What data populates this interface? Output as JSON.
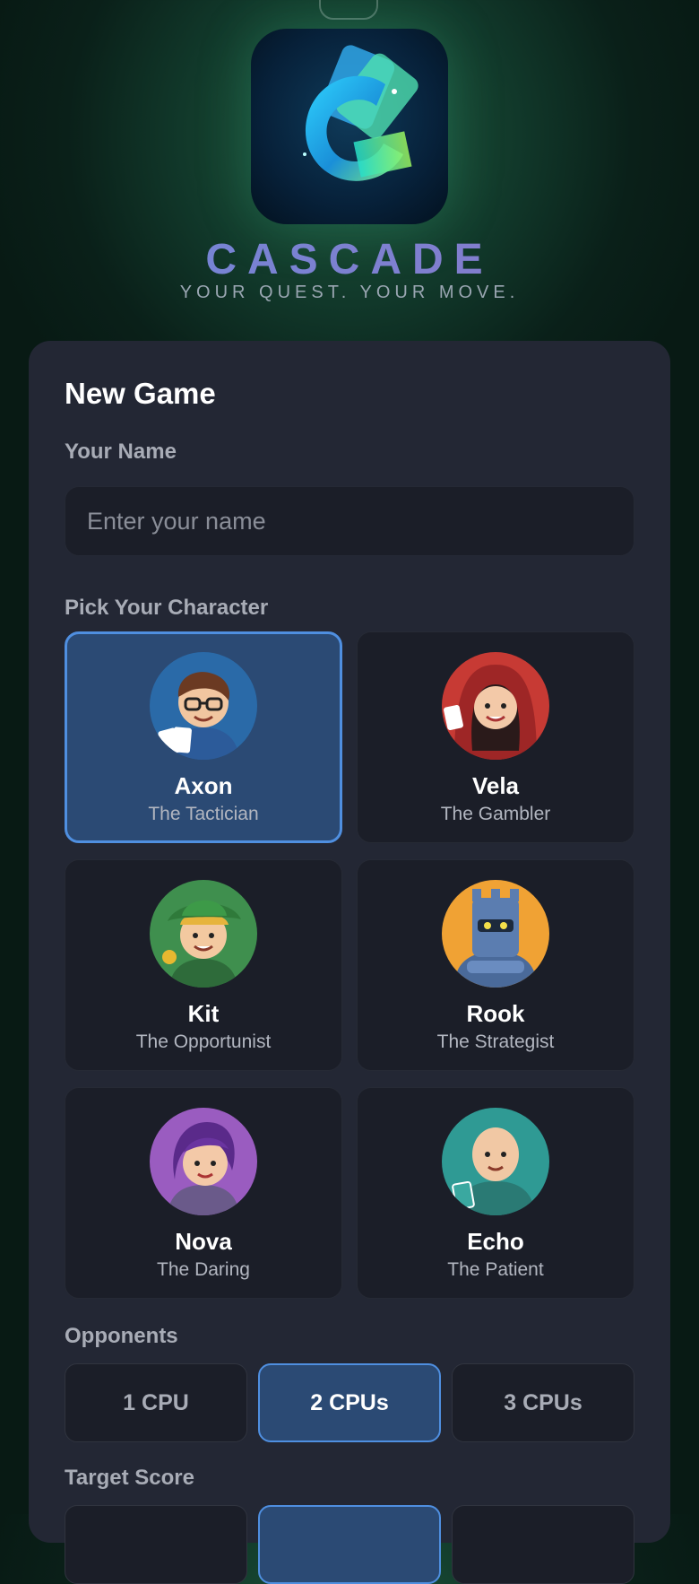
{
  "brand": {
    "title": "CASCADE",
    "tagline": "YOUR QUEST. YOUR MOVE."
  },
  "form": {
    "heading": "New Game",
    "name_label": "Your Name",
    "name_placeholder": "Enter your name",
    "name_value": "",
    "character_label": "Pick Your Character",
    "characters": [
      {
        "name": "Axon",
        "title": "The Tactician",
        "selected": true
      },
      {
        "name": "Vela",
        "title": "The Gambler",
        "selected": false
      },
      {
        "name": "Kit",
        "title": "The Opportunist",
        "selected": false
      },
      {
        "name": "Rook",
        "title": "The Strategist",
        "selected": false
      },
      {
        "name": "Nova",
        "title": "The Daring",
        "selected": false
      },
      {
        "name": "Echo",
        "title": "The Patient",
        "selected": false
      }
    ],
    "opponents_label": "Opponents",
    "opponents": [
      {
        "label": "1 CPU",
        "selected": false
      },
      {
        "label": "2 CPUs",
        "selected": true
      },
      {
        "label": "3 CPUs",
        "selected": false
      }
    ],
    "target_label": "Target Score"
  },
  "colors": {
    "accent": "#4f8fe0",
    "selected_bg": "#2b4a74",
    "card_bg": "#232734",
    "tile_bg": "#1b1e28"
  }
}
